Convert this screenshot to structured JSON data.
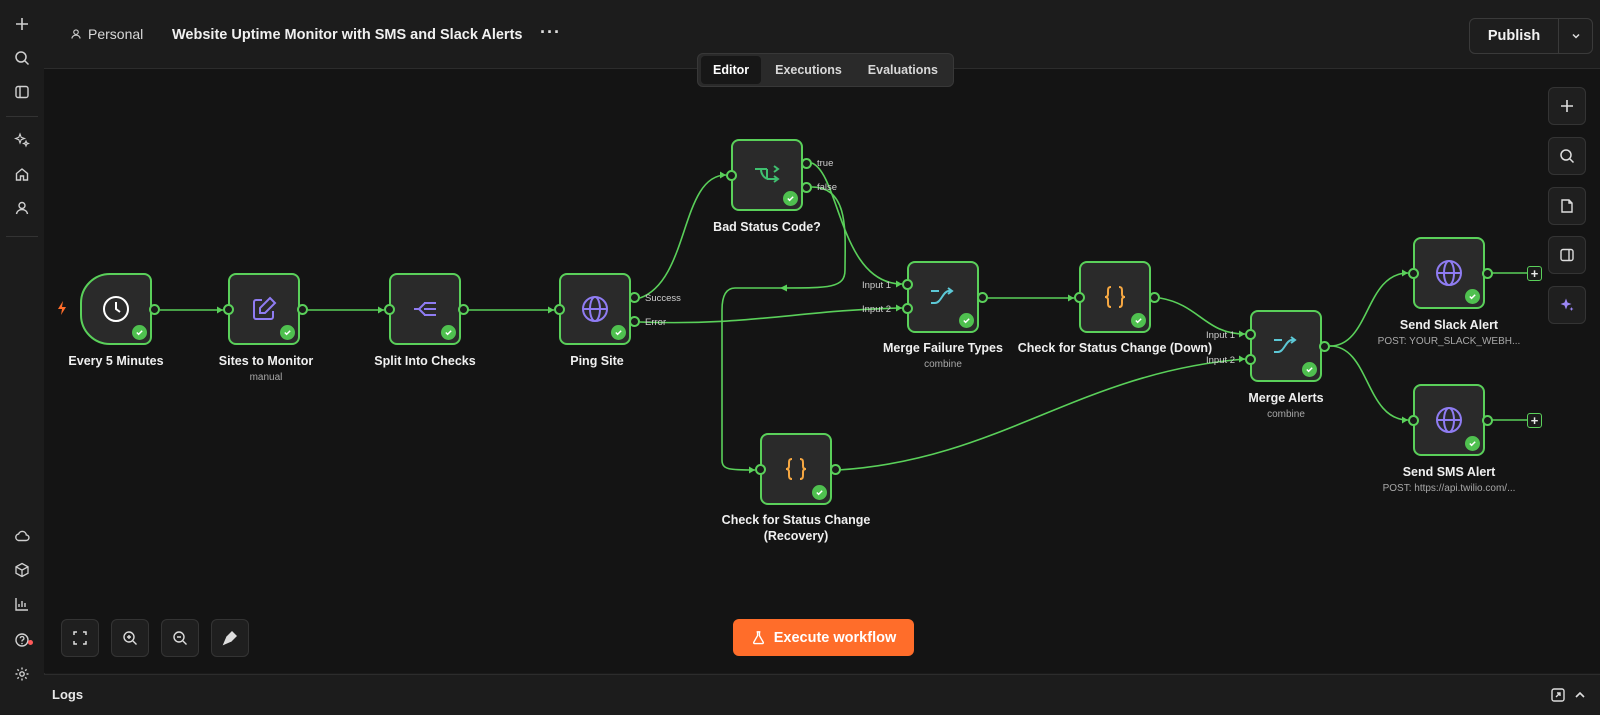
{
  "header": {
    "breadcrumb": "Personal",
    "title": "Website Uptime Monitor with SMS and Slack Alerts",
    "more_label": "···",
    "publish_label": "Publish"
  },
  "tabs": [
    {
      "label": "Editor",
      "active": true
    },
    {
      "label": "Executions",
      "active": false
    },
    {
      "label": "Evaluations",
      "active": false
    }
  ],
  "nodes": {
    "every5": {
      "label": "Every 5 Minutes",
      "icon": "clock-icon"
    },
    "sites": {
      "label": "Sites to Monitor",
      "sub": "manual",
      "icon": "edit-icon"
    },
    "split": {
      "label": "Split Into Checks",
      "icon": "split-icon"
    },
    "ping": {
      "label": "Ping Site",
      "icon": "globe-icon",
      "out1": "Success",
      "out2": "Error"
    },
    "badstatus": {
      "label": "Bad Status Code?",
      "icon": "if-icon",
      "out1": "true",
      "out2": "false"
    },
    "mergefail": {
      "label": "Merge Failure Types",
      "sub": "combine",
      "icon": "merge-icon",
      "in1": "Input 1",
      "in2": "Input 2"
    },
    "checkdown": {
      "label": "Check for Status Change (Down)",
      "icon": "code-icon"
    },
    "checkrec": {
      "label": "Check for Status Change (Recovery)",
      "icon": "code-icon"
    },
    "mergealerts": {
      "label": "Merge Alerts",
      "sub": "combine",
      "icon": "merge-icon",
      "in1": "Input 1",
      "in2": "Input 2"
    },
    "slack": {
      "label": "Send Slack Alert",
      "sub": "POST: YOUR_SLACK_WEBH...",
      "icon": "globe-icon"
    },
    "sms": {
      "label": "Send SMS Alert",
      "sub": "POST: https://api.twilio.com/...",
      "icon": "globe-icon"
    }
  },
  "execute_label": "Execute workflow",
  "logs_label": "Logs",
  "colors": {
    "accent": "#ff6d2a",
    "connection": "#5ad05a",
    "node_bg": "#2a2a2a",
    "canvas": "#141414"
  }
}
